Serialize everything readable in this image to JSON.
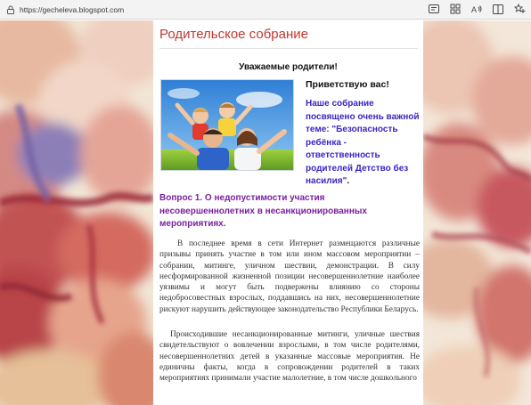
{
  "browser": {
    "url": "https://gecheleva.blogspot.com"
  },
  "blog": {
    "title": "Родительское собрание"
  },
  "post": {
    "greeting": "Уважаемые родители!",
    "hello": "Приветствую вас!",
    "intro": "Наше собрание посвящено очень важной теме: \"Безопасность ребёнка - ответственность родителей Детство без насилия\"",
    "intro_end": ".",
    "question": "Вопрос 1. О недопустимости участия несовершеннолетних в несанкционированных мероприятиях.",
    "paragraph1": "В последнее время в сети Интернет размещаются различные призывы принять участие в том или ином массовом мероприятии – собрании, митинге, уличном шествии, демонстрации. В силу несформированной жизненной позиции несовершеннолетние наиболее уязвимы и могут быть подвержены влиянию со стороны недобросовестных взрослых, поддавшись на них, несовершеннолетние рискуют нарушить действующее законодательство Республики Беларусь.",
    "paragraph2": "Происходившие несанкционированные митинги, уличные шествия свидетельствуют о вовлечении взрослыми, в том числе родителями, несовершеннолетних детей в указанные массовые мероприятия. Не единичны факты, когда в сопровождении родителей в таких мероприятиях принимали участие малолетние, в том числе дошкольного"
  },
  "icons": [
    "lock-icon",
    "reader-view-icon",
    "apps-icon",
    "read-aloud-icon",
    "split-screen-icon",
    "favorites-icon"
  ],
  "colors": {
    "title": "#c0372f",
    "intro": "#3a26c4",
    "question": "#7a1fa0"
  }
}
